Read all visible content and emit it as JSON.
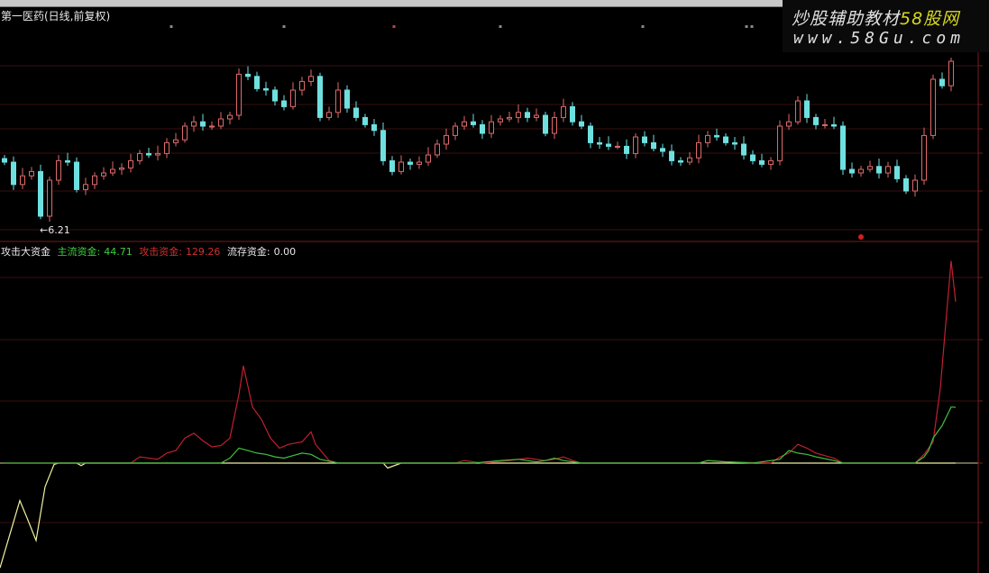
{
  "header": {
    "title": "第一医药(日线,前复权)"
  },
  "watermark": {
    "brand": "炒股辅助教材",
    "brand_highlight": "58股网",
    "url": "www.58Gu.com"
  },
  "price_panel": {
    "min_marker": "←6.21"
  },
  "indicator": {
    "name": "攻击大资金",
    "items": [
      {
        "label": "主流资金:",
        "value": "44.71",
        "color": "#40d040"
      },
      {
        "label": "攻击资金:",
        "value": "129.26",
        "color": "#d03030"
      },
      {
        "label": "流存资金:",
        "value": "0.00",
        "color": "#e8e8e8"
      }
    ]
  },
  "colors": {
    "up": "#e06a6a",
    "down": "#6fe0e0",
    "yellow": "#f0f0a0",
    "green": "#40c040",
    "red": "#c02030",
    "grid": "#3a0f0f"
  },
  "chart_data": [
    {
      "type": "candlestick",
      "title": "第一医药(日线,前复权)",
      "min_price": 6.21,
      "closes": [
        7.06,
        6.75,
        6.87,
        6.93,
        6.31,
        6.81,
        7.08,
        7.06,
        6.68,
        6.75,
        6.87,
        6.91,
        6.96,
        6.98,
        7.08,
        7.18,
        7.16,
        7.18,
        7.33,
        7.37,
        7.56,
        7.62,
        7.56,
        7.56,
        7.66,
        7.71,
        8.28,
        8.25,
        8.08,
        8.06,
        7.91,
        7.83,
        8.06,
        8.18,
        8.25,
        7.68,
        7.75,
        8.06,
        7.81,
        7.68,
        7.58,
        7.5,
        7.08,
        6.93,
        7.06,
        7.03,
        7.06,
        7.16,
        7.31,
        7.43,
        7.56,
        7.62,
        7.58,
        7.46,
        7.62,
        7.66,
        7.68,
        7.75,
        7.68,
        7.71,
        7.46,
        7.68,
        7.83,
        7.62,
        7.56,
        7.33,
        7.31,
        7.28,
        7.28,
        7.18,
        7.41,
        7.33,
        7.25,
        7.21,
        7.08,
        7.06,
        7.12,
        7.33,
        7.43,
        7.41,
        7.33,
        7.31,
        7.16,
        7.08,
        7.03,
        7.08,
        7.56,
        7.62,
        7.91,
        7.68,
        7.58,
        7.58,
        7.56,
        6.96,
        6.91,
        6.96,
        7.0,
        6.91,
        7.0,
        6.83,
        6.66,
        6.81,
        7.43,
        8.21,
        8.12,
        8.46
      ]
    },
    {
      "type": "line",
      "title": "攻击大资金",
      "series": [
        {
          "name": "流存资金",
          "knots": [
            [
              -0.5,
              -84
            ],
            [
              1.7,
              -30
            ],
            [
              2.5,
              -44
            ],
            [
              3.5,
              -62
            ],
            [
              4.5,
              -19
            ],
            [
              5.5,
              -1
            ],
            [
              6,
              0
            ],
            [
              8,
              0
            ],
            [
              8.5,
              -2
            ],
            [
              9,
              0
            ],
            [
              42,
              0
            ],
            [
              42.5,
              -4
            ],
            [
              44,
              0
            ],
            [
              105.5,
              0
            ]
          ]
        },
        {
          "name": "攻击资金",
          "knots": [
            [
              0,
              0
            ],
            [
              14,
              0
            ],
            [
              15,
              5
            ],
            [
              17,
              3
            ],
            [
              18,
              8
            ],
            [
              19,
              10
            ],
            [
              20,
              20
            ],
            [
              21,
              24
            ],
            [
              22,
              18
            ],
            [
              23,
              13
            ],
            [
              24,
              14
            ],
            [
              25,
              20
            ],
            [
              26,
              55
            ],
            [
              26.5,
              78
            ],
            [
              27.5,
              45
            ],
            [
              28.5,
              35
            ],
            [
              29.5,
              20
            ],
            [
              30.5,
              12
            ],
            [
              31.5,
              15
            ],
            [
              33,
              17
            ],
            [
              34,
              25
            ],
            [
              34.5,
              15
            ],
            [
              36,
              2
            ],
            [
              37,
              0
            ],
            [
              50,
              0
            ],
            [
              51,
              2
            ],
            [
              53,
              0
            ],
            [
              56,
              2
            ],
            [
              58,
              4
            ],
            [
              60,
              2
            ],
            [
              61,
              3
            ],
            [
              62,
              5
            ],
            [
              63,
              2
            ],
            [
              64,
              0
            ],
            [
              77,
              0
            ],
            [
              78,
              2
            ],
            [
              80,
              1
            ],
            [
              85,
              0
            ],
            [
              86,
              5
            ],
            [
              87,
              8
            ],
            [
              88,
              15
            ],
            [
              89,
              12
            ],
            [
              90,
              8
            ],
            [
              92,
              4
            ],
            [
              93,
              0
            ],
            [
              101,
              0
            ],
            [
              102,
              7
            ],
            [
              103,
              17
            ],
            [
              103.8,
              60
            ],
            [
              104.5,
              120
            ],
            [
              105,
              162
            ],
            [
              105.5,
              129.26
            ]
          ]
        },
        {
          "name": "主流资金",
          "knots": [
            [
              0,
              0
            ],
            [
              24,
              0
            ],
            [
              25,
              4
            ],
            [
              26,
              12
            ],
            [
              27,
              10
            ],
            [
              28,
              8
            ],
            [
              29,
              7
            ],
            [
              30,
              5
            ],
            [
              31,
              4
            ],
            [
              32,
              6
            ],
            [
              33,
              8
            ],
            [
              34,
              7
            ],
            [
              35,
              3
            ],
            [
              37,
              0
            ],
            [
              52,
              0
            ],
            [
              55,
              2
            ],
            [
              57,
              3
            ],
            [
              59,
              1
            ],
            [
              60,
              2
            ],
            [
              61,
              4
            ],
            [
              62,
              2
            ],
            [
              64,
              0
            ],
            [
              77,
              0
            ],
            [
              78,
              2
            ],
            [
              80,
              1
            ],
            [
              83,
              0
            ],
            [
              86,
              3
            ],
            [
              87,
              10
            ],
            [
              88,
              8
            ],
            [
              89,
              7
            ],
            [
              90,
              5
            ],
            [
              92,
              2
            ],
            [
              93,
              0
            ],
            [
              101,
              0
            ],
            [
              102,
              5
            ],
            [
              102.5,
              10
            ],
            [
              103,
              20
            ],
            [
              104,
              30
            ],
            [
              105,
              45
            ],
            [
              105.5,
              44.71
            ]
          ]
        }
      ]
    }
  ]
}
